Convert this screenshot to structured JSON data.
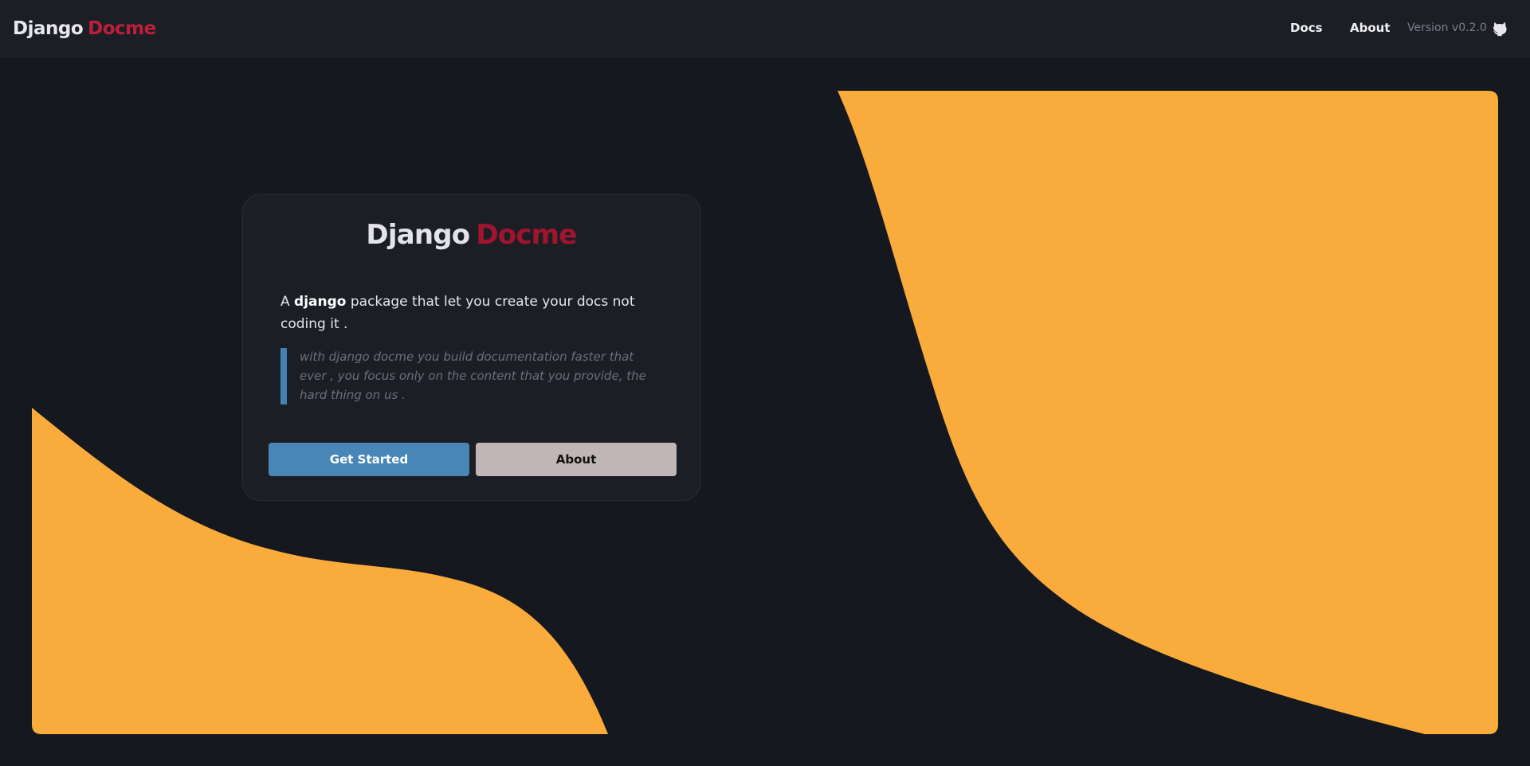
{
  "brand": {
    "first": "Django",
    "second": "Docme"
  },
  "nav": {
    "docs_label": "Docs",
    "about_label": "About",
    "version": "Version v0.2.0",
    "github_icon": "github-icon"
  },
  "hero": {
    "title_first": "Django",
    "title_second": "Docme",
    "desc_pre": "A ",
    "desc_bold": "django",
    "desc_post": " package that let you create your docs not coding it .",
    "quote": "with django docme you build documentation faster that ever , you focus only on the content that you provide, the hard thing on us .",
    "primary_button": "Get Started",
    "secondary_button": "About"
  },
  "colors": {
    "background": "#16181f",
    "navbar": "#1c1e26",
    "accent_red": "#be1e3c",
    "accent_blue": "#4786b6",
    "shape_orange": "#f9ab3b",
    "secondary_button": "#c0b6b5"
  }
}
